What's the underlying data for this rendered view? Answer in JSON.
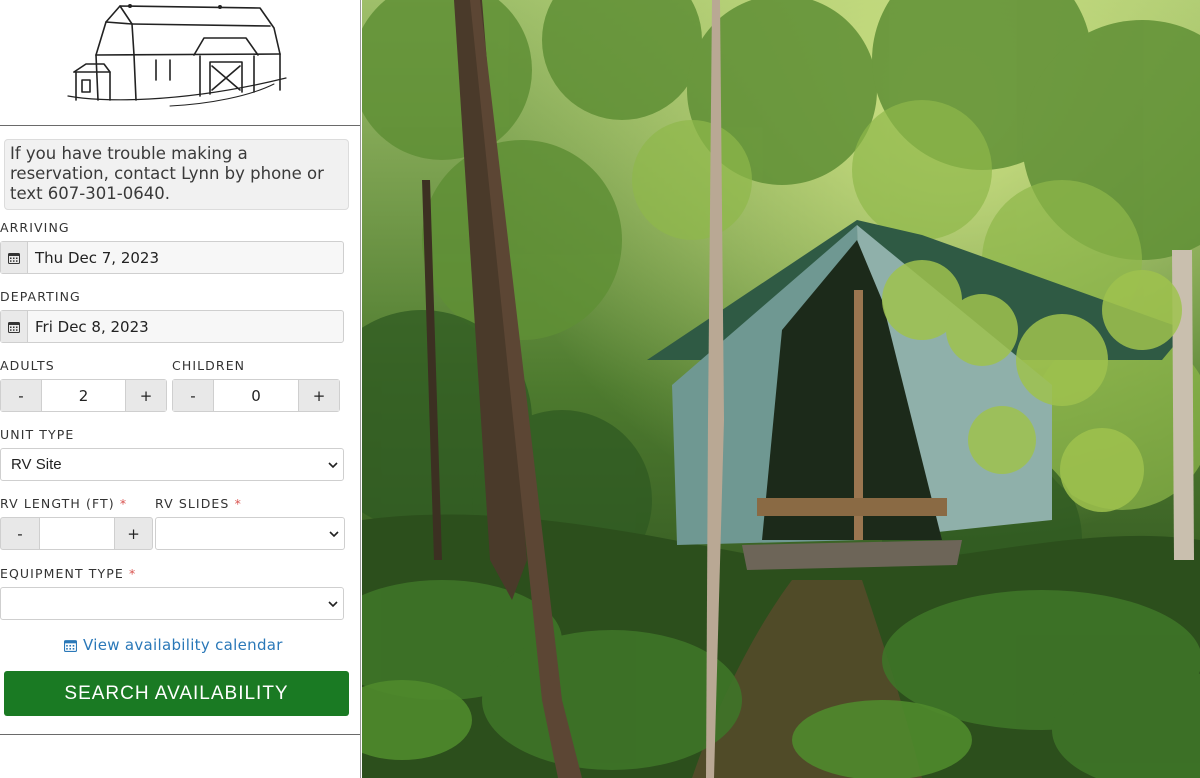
{
  "notice": {
    "text": "If you have trouble making a reservation, contact Lynn by phone or text 607-301-0640."
  },
  "arriving": {
    "label": "ARRIVING",
    "value": "Thu Dec 7, 2023"
  },
  "departing": {
    "label": "DEPARTING",
    "value": "Fri Dec 8, 2023"
  },
  "adults": {
    "label": "ADULTS",
    "minus": "-",
    "value": "2",
    "plus": "+"
  },
  "children": {
    "label": "CHILDREN",
    "minus": "-",
    "value": "0",
    "plus": "+"
  },
  "unit_type": {
    "label": "UNIT TYPE",
    "value": "RV Site"
  },
  "rv_length": {
    "label": "RV LENGTH (FT)",
    "required": "*",
    "minus": "-",
    "value": "",
    "plus": "+"
  },
  "rv_slides": {
    "label": "RV SLIDES",
    "required": "*",
    "value": ""
  },
  "equipment_type": {
    "label": "EQUIPMENT TYPE",
    "required": "*",
    "value": ""
  },
  "calendar_link": {
    "label": "View availability calendar"
  },
  "search_button": {
    "label": "SEARCH AVAILABILITY"
  },
  "icons": [
    "barn-logo",
    "calendar-icon",
    "chevron-down-icon"
  ],
  "colors": {
    "accent_green": "#1a7a23",
    "link_blue": "#2a78b8",
    "required_red": "#d9534f"
  }
}
